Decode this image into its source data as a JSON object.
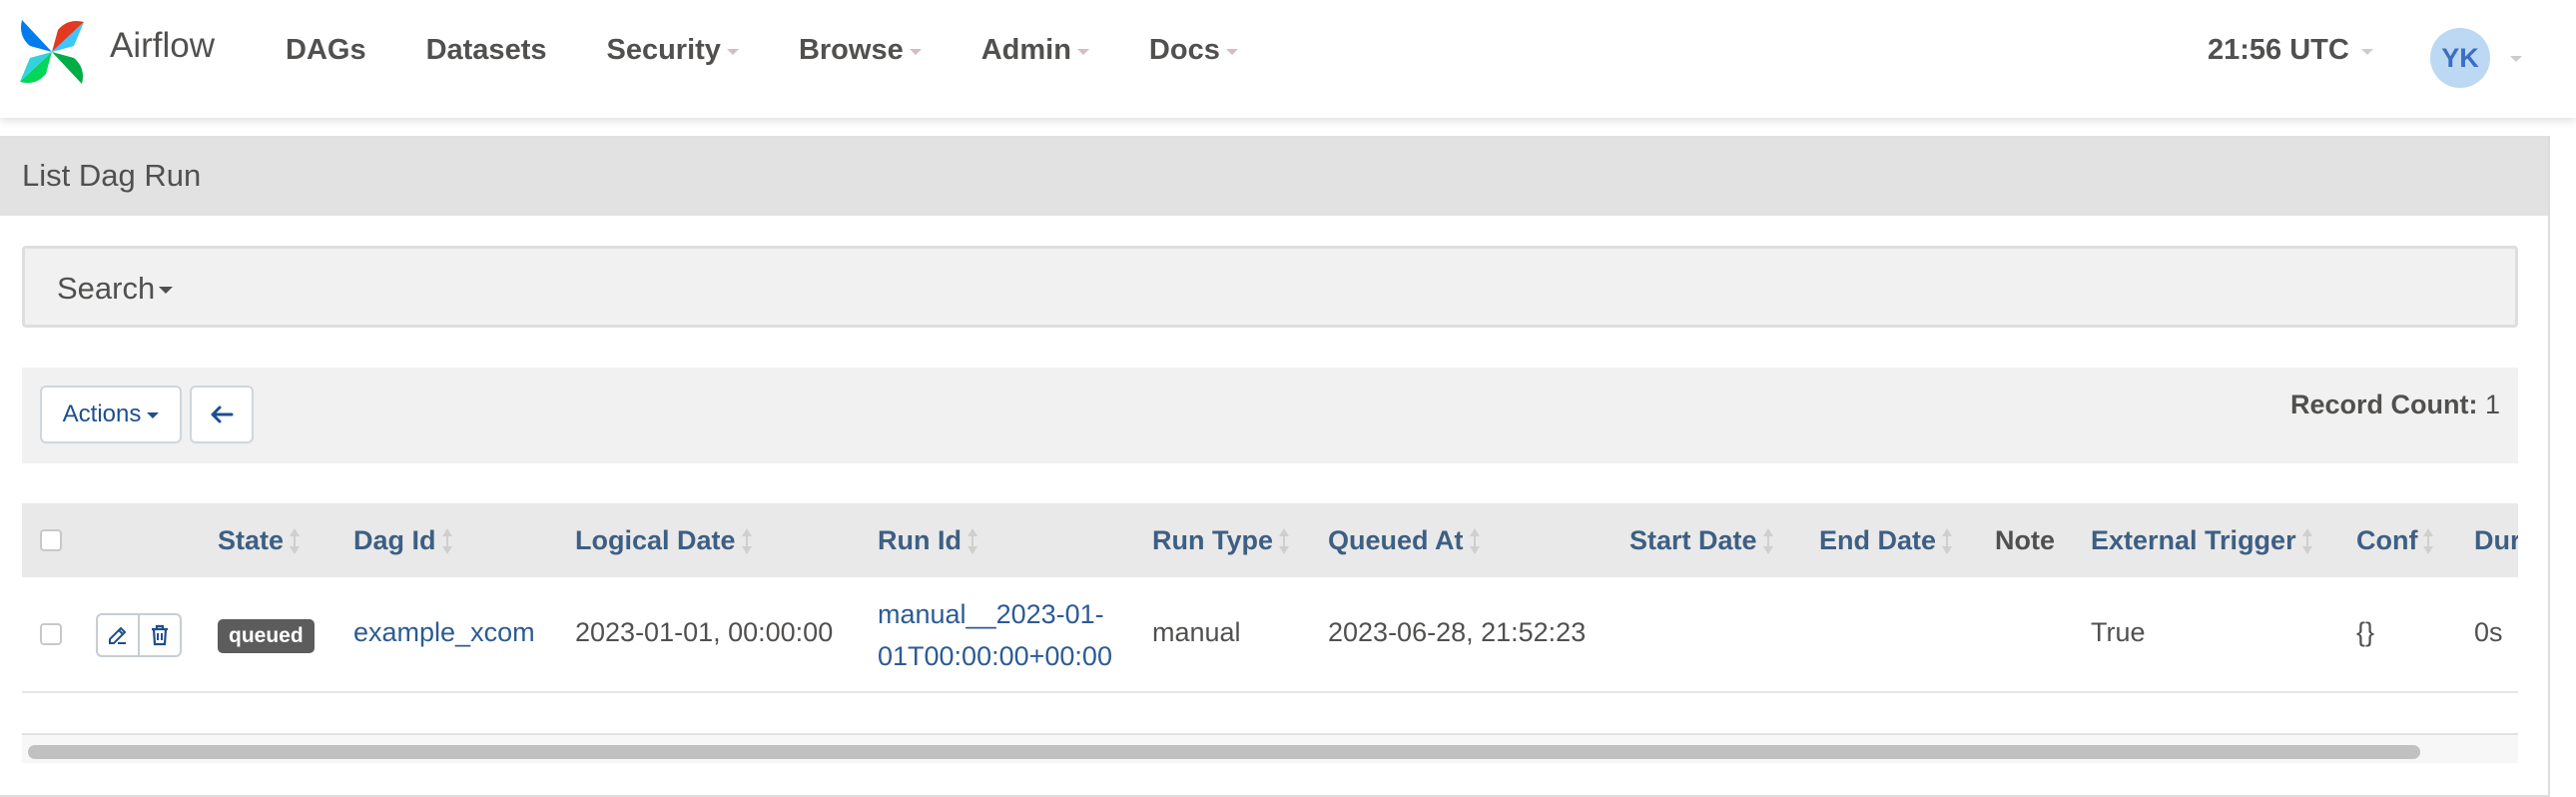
{
  "navbar": {
    "brand": "Airflow",
    "items": [
      {
        "label": "DAGs",
        "dropdown": false
      },
      {
        "label": "Datasets",
        "dropdown": false
      },
      {
        "label": "Security",
        "dropdown": true
      },
      {
        "label": "Browse",
        "dropdown": true
      },
      {
        "label": "Admin",
        "dropdown": true
      },
      {
        "label": "Docs",
        "dropdown": true
      }
    ],
    "time": "21:56 UTC",
    "avatar": "YK"
  },
  "panel": {
    "title": "List Dag Run",
    "search_label": "Search",
    "actions_label": "Actions",
    "record_count_label": "Record Count:",
    "record_count": "1"
  },
  "table": {
    "headers": [
      "State",
      "Dag Id",
      "Logical Date",
      "Run Id",
      "Run Type",
      "Queued At",
      "Start Date",
      "End Date",
      "Note",
      "External Trigger",
      "Conf",
      "Dur"
    ],
    "rows": [
      {
        "state": "queued",
        "dag_id": "example_xcom",
        "logical_date": "2023-01-01, 00:00:00",
        "run_id_line1": "manual__2023-01-",
        "run_id_line2": "01T00:00:00+00:00",
        "run_type": "manual",
        "queued_at": "2023-06-28, 21:52:23",
        "start_date": "",
        "end_date": "",
        "note": "",
        "external_trigger": "True",
        "conf": "{}",
        "duration": "0s"
      }
    ]
  },
  "colors": {
    "link": "#2b5b95",
    "state_queued": "#5c5c5c",
    "avatar_bg": "#bcd8f3"
  }
}
